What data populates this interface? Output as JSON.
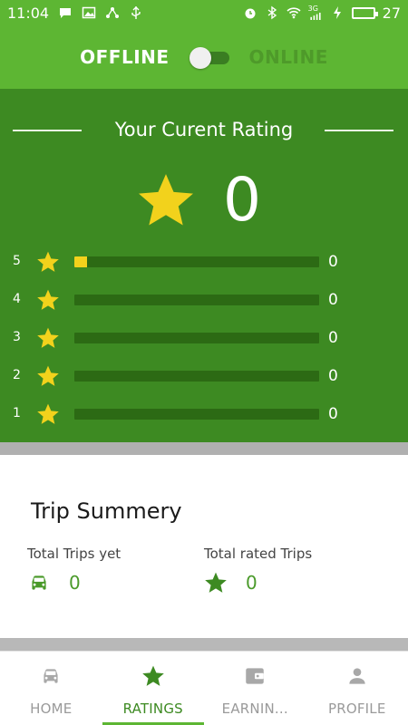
{
  "status_bar": {
    "time": "11:04",
    "network": "3G",
    "battery": "27"
  },
  "header": {
    "offline_label": "OFFLINE",
    "online_label": "ONLINE",
    "toggle_state": "offline"
  },
  "rating": {
    "title": "Your Curent Rating",
    "value": "0",
    "rows": [
      {
        "stars": "5",
        "count": "0",
        "fill": 0.05
      },
      {
        "stars": "4",
        "count": "0",
        "fill": 0
      },
      {
        "stars": "3",
        "count": "0",
        "fill": 0
      },
      {
        "stars": "2",
        "count": "0",
        "fill": 0
      },
      {
        "stars": "1",
        "count": "0",
        "fill": 0
      }
    ]
  },
  "trip_summary": {
    "title": "Trip Summery",
    "total_trips_label": "Total Trips yet",
    "total_trips_value": "0",
    "total_rated_label": "Total rated Trips",
    "total_rated_value": "0"
  },
  "bottom_nav": {
    "items": [
      {
        "label": "HOME",
        "icon": "car-icon"
      },
      {
        "label": "RATINGS",
        "icon": "star-icon"
      },
      {
        "label": "EARNIN...",
        "icon": "wallet-icon"
      },
      {
        "label": "PROFILE",
        "icon": "person-icon"
      }
    ],
    "active": "RATINGS"
  },
  "colors": {
    "primary": "#5db633",
    "panel": "#3d8a22",
    "bar_track": "#2c6a14",
    "star": "#f2d21c",
    "accent_text": "#4a9a2a"
  }
}
